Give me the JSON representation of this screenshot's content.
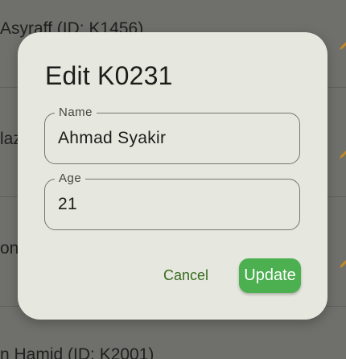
{
  "background_list": {
    "items": [
      {
        "text": "Asyraff (ID: K1456)"
      },
      {
        "text": "laz"
      },
      {
        "text": "on"
      },
      {
        "text": "n Hamid (ID: K2001)"
      }
    ],
    "edit_icon": "pencil-icon",
    "edit_icon_color": "#c98a1e"
  },
  "dialog": {
    "title": "Edit K0231",
    "fields": {
      "name": {
        "label": "Name",
        "value": "Ahmad Syakir"
      },
      "age": {
        "label": "Age",
        "value": "21"
      }
    },
    "actions": {
      "cancel_label": "Cancel",
      "update_label": "Update"
    },
    "colors": {
      "surface": "#e6e8df",
      "primary_text": "#386a20",
      "update_button": "#4caf50"
    }
  }
}
